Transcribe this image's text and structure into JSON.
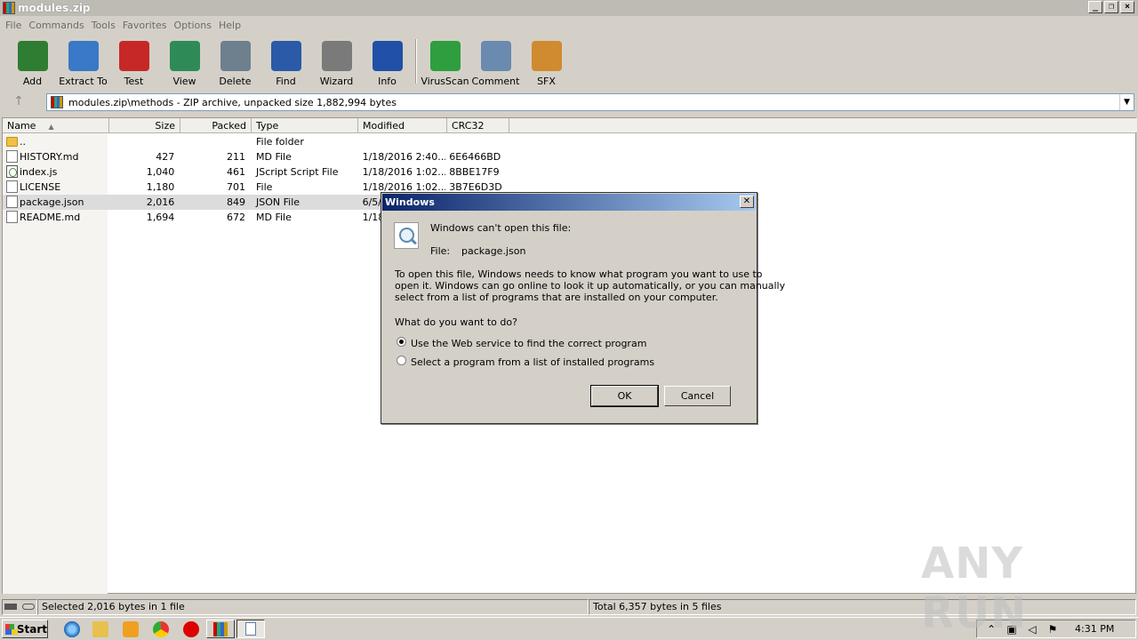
{
  "window": {
    "title": "modules.zip"
  },
  "menu": [
    "File",
    "Commands",
    "Tools",
    "Favorites",
    "Options",
    "Help"
  ],
  "toolbar": {
    "buttons": [
      {
        "label": "Add",
        "icon": "add-archive-icon",
        "color": "#2e7d32"
      },
      {
        "label": "Extract To",
        "icon": "extract-folder-icon",
        "color": "#3a78c8"
      },
      {
        "label": "Test",
        "icon": "test-clipboard-icon",
        "color": "#c62828"
      },
      {
        "label": "View",
        "icon": "view-book-icon",
        "color": "#2e8b57"
      },
      {
        "label": "Delete",
        "icon": "delete-trash-icon",
        "color": "#6e7f8e"
      },
      {
        "label": "Find",
        "icon": "find-magnifier-icon",
        "color": "#2a5aa8"
      },
      {
        "label": "Wizard",
        "icon": "wizard-wand-icon",
        "color": "#7a7a7a"
      },
      {
        "label": "Info",
        "icon": "info-icon",
        "color": "#2050a8"
      },
      {
        "label": "VirusScan",
        "icon": "virus-scan-icon",
        "color": "#2e9e3e"
      },
      {
        "label": "Comment",
        "icon": "comment-icon",
        "color": "#6a8ab0"
      },
      {
        "label": "SFX",
        "icon": "sfx-box-icon",
        "color": "#d08a30"
      }
    ]
  },
  "address": {
    "path": "modules.zip\\methods - ZIP archive, unpacked size 1,882,994 bytes"
  },
  "columns": [
    "Name",
    "Size",
    "Packed",
    "Type",
    "Modified",
    "CRC32"
  ],
  "files": [
    {
      "name": "..",
      "size": "",
      "packed": "",
      "type": "File folder",
      "modified": "",
      "crc": "",
      "icon": "folder"
    },
    {
      "name": "HISTORY.md",
      "size": "427",
      "packed": "211",
      "type": "MD File",
      "modified": "1/18/2016 2:40...",
      "crc": "6E6466BD",
      "icon": "doc"
    },
    {
      "name": "index.js",
      "size": "1,040",
      "packed": "461",
      "type": "JScript Script File",
      "modified": "1/18/2016 1:02...",
      "crc": "8BBE17F9",
      "icon": "js"
    },
    {
      "name": "LICENSE",
      "size": "1,180",
      "packed": "701",
      "type": "File",
      "modified": "1/18/2016 1:02...",
      "crc": "3B7E6D3D",
      "icon": "doc"
    },
    {
      "name": "package.json",
      "size": "2,016",
      "packed": "849",
      "type": "JSON File",
      "modified": "6/5/",
      "crc": "",
      "icon": "doc",
      "selected": true
    },
    {
      "name": "README.md",
      "size": "1,694",
      "packed": "672",
      "type": "MD File",
      "modified": "1/18",
      "crc": "",
      "icon": "doc"
    }
  ],
  "status": {
    "left": "Selected 2,016 bytes in 1 file",
    "right": "Total 6,357 bytes in 5 files"
  },
  "taskbar": {
    "start": "Start",
    "clock": "4:31 PM"
  },
  "dialog": {
    "title": "Windows",
    "heading": "Windows can't open this file:",
    "file_label": "File:",
    "file_name": "package.json",
    "body1": "To open this file, Windows needs to know what program you want to use to",
    "body2": "open it. Windows can go online to look it up automatically, or you can manually",
    "body3": "select from a list of programs that are installed on your computer.",
    "question": "What do you want to do?",
    "option1": "Use the Web service to find the correct program",
    "option2": "Select a program from a list of installed programs",
    "ok": "OK",
    "cancel": "Cancel"
  },
  "watermark": "ANY RUN"
}
